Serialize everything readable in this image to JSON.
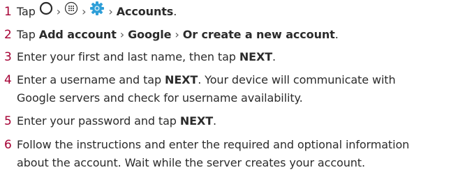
{
  "colors": {
    "step_number": "#a50034",
    "text": "#2b2b2b",
    "settings_icon": "#2f9fd8"
  },
  "steps": [
    {
      "number": "1",
      "text_tap": "Tap",
      "separator": "›",
      "icons": [
        "home-circle-icon",
        "apps-grid-icon",
        "settings-gear-icon"
      ],
      "accounts": "Accounts",
      "end": "."
    },
    {
      "number": "2",
      "text_tap": "Tap",
      "add_account": "Add account",
      "separator": "›",
      "google": "Google",
      "create_new": "Or create a new account",
      "end": "."
    },
    {
      "number": "3",
      "pre": "Enter your first and last name, then tap",
      "next": "NEXT",
      "end": "."
    },
    {
      "number": "4",
      "pre": "Enter a username and tap",
      "next": "NEXT",
      "post": ". Your device will communicate with",
      "line2": "Google servers and check for username availability."
    },
    {
      "number": "5",
      "pre": "Enter your password and tap",
      "next": "NEXT",
      "end": "."
    },
    {
      "number": "6",
      "line1": "Follow the instructions and enter the required and optional information",
      "line2": "about the account. Wait while the server creates your account."
    }
  ]
}
